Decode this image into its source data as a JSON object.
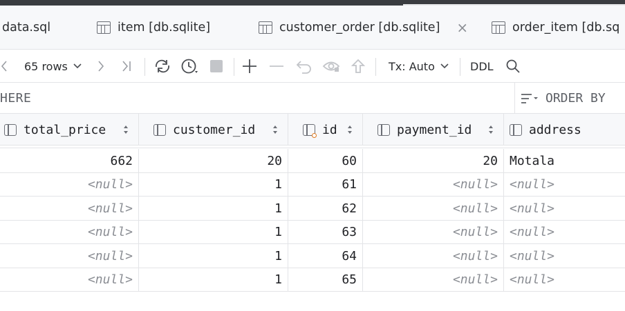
{
  "tabs": [
    {
      "label": "data.sql",
      "icon": "none",
      "active": false
    },
    {
      "label": "item [db.sqlite]",
      "icon": "table-icon",
      "active": false
    },
    {
      "label": "customer_order [db.sqlite]",
      "icon": "table-icon",
      "active": true,
      "close": "×"
    },
    {
      "label": "order_item [db.sq",
      "icon": "table-icon",
      "active": false
    }
  ],
  "toolbar": {
    "rows_label": "65 rows",
    "tx_label": "Tx: Auto",
    "ddl_label": "DDL"
  },
  "filter": {
    "where_text": "HERE",
    "orderby_text": "ORDER BY"
  },
  "table": {
    "columns": [
      {
        "name": "total_price",
        "key": false
      },
      {
        "name": "customer_id",
        "key": false
      },
      {
        "name": "id",
        "key": true
      },
      {
        "name": "payment_id",
        "key": false
      },
      {
        "name": "address",
        "key": false
      }
    ],
    "rows": [
      [
        "662",
        "20",
        "60",
        "20",
        "Motala"
      ],
      [
        "<null>",
        "1",
        "61",
        "<null>",
        "<null>"
      ],
      [
        "<null>",
        "1",
        "62",
        "<null>",
        "<null>"
      ],
      [
        "<null>",
        "1",
        "63",
        "<null>",
        "<null>"
      ],
      [
        "<null>",
        "1",
        "64",
        "<null>",
        "<null>"
      ],
      [
        "<null>",
        "1",
        "65",
        "<null>",
        "<null>"
      ]
    ]
  },
  "colors": {
    "accent": "#3574f0",
    "key": "#e07a1f",
    "null_text": "#8a8d93"
  }
}
